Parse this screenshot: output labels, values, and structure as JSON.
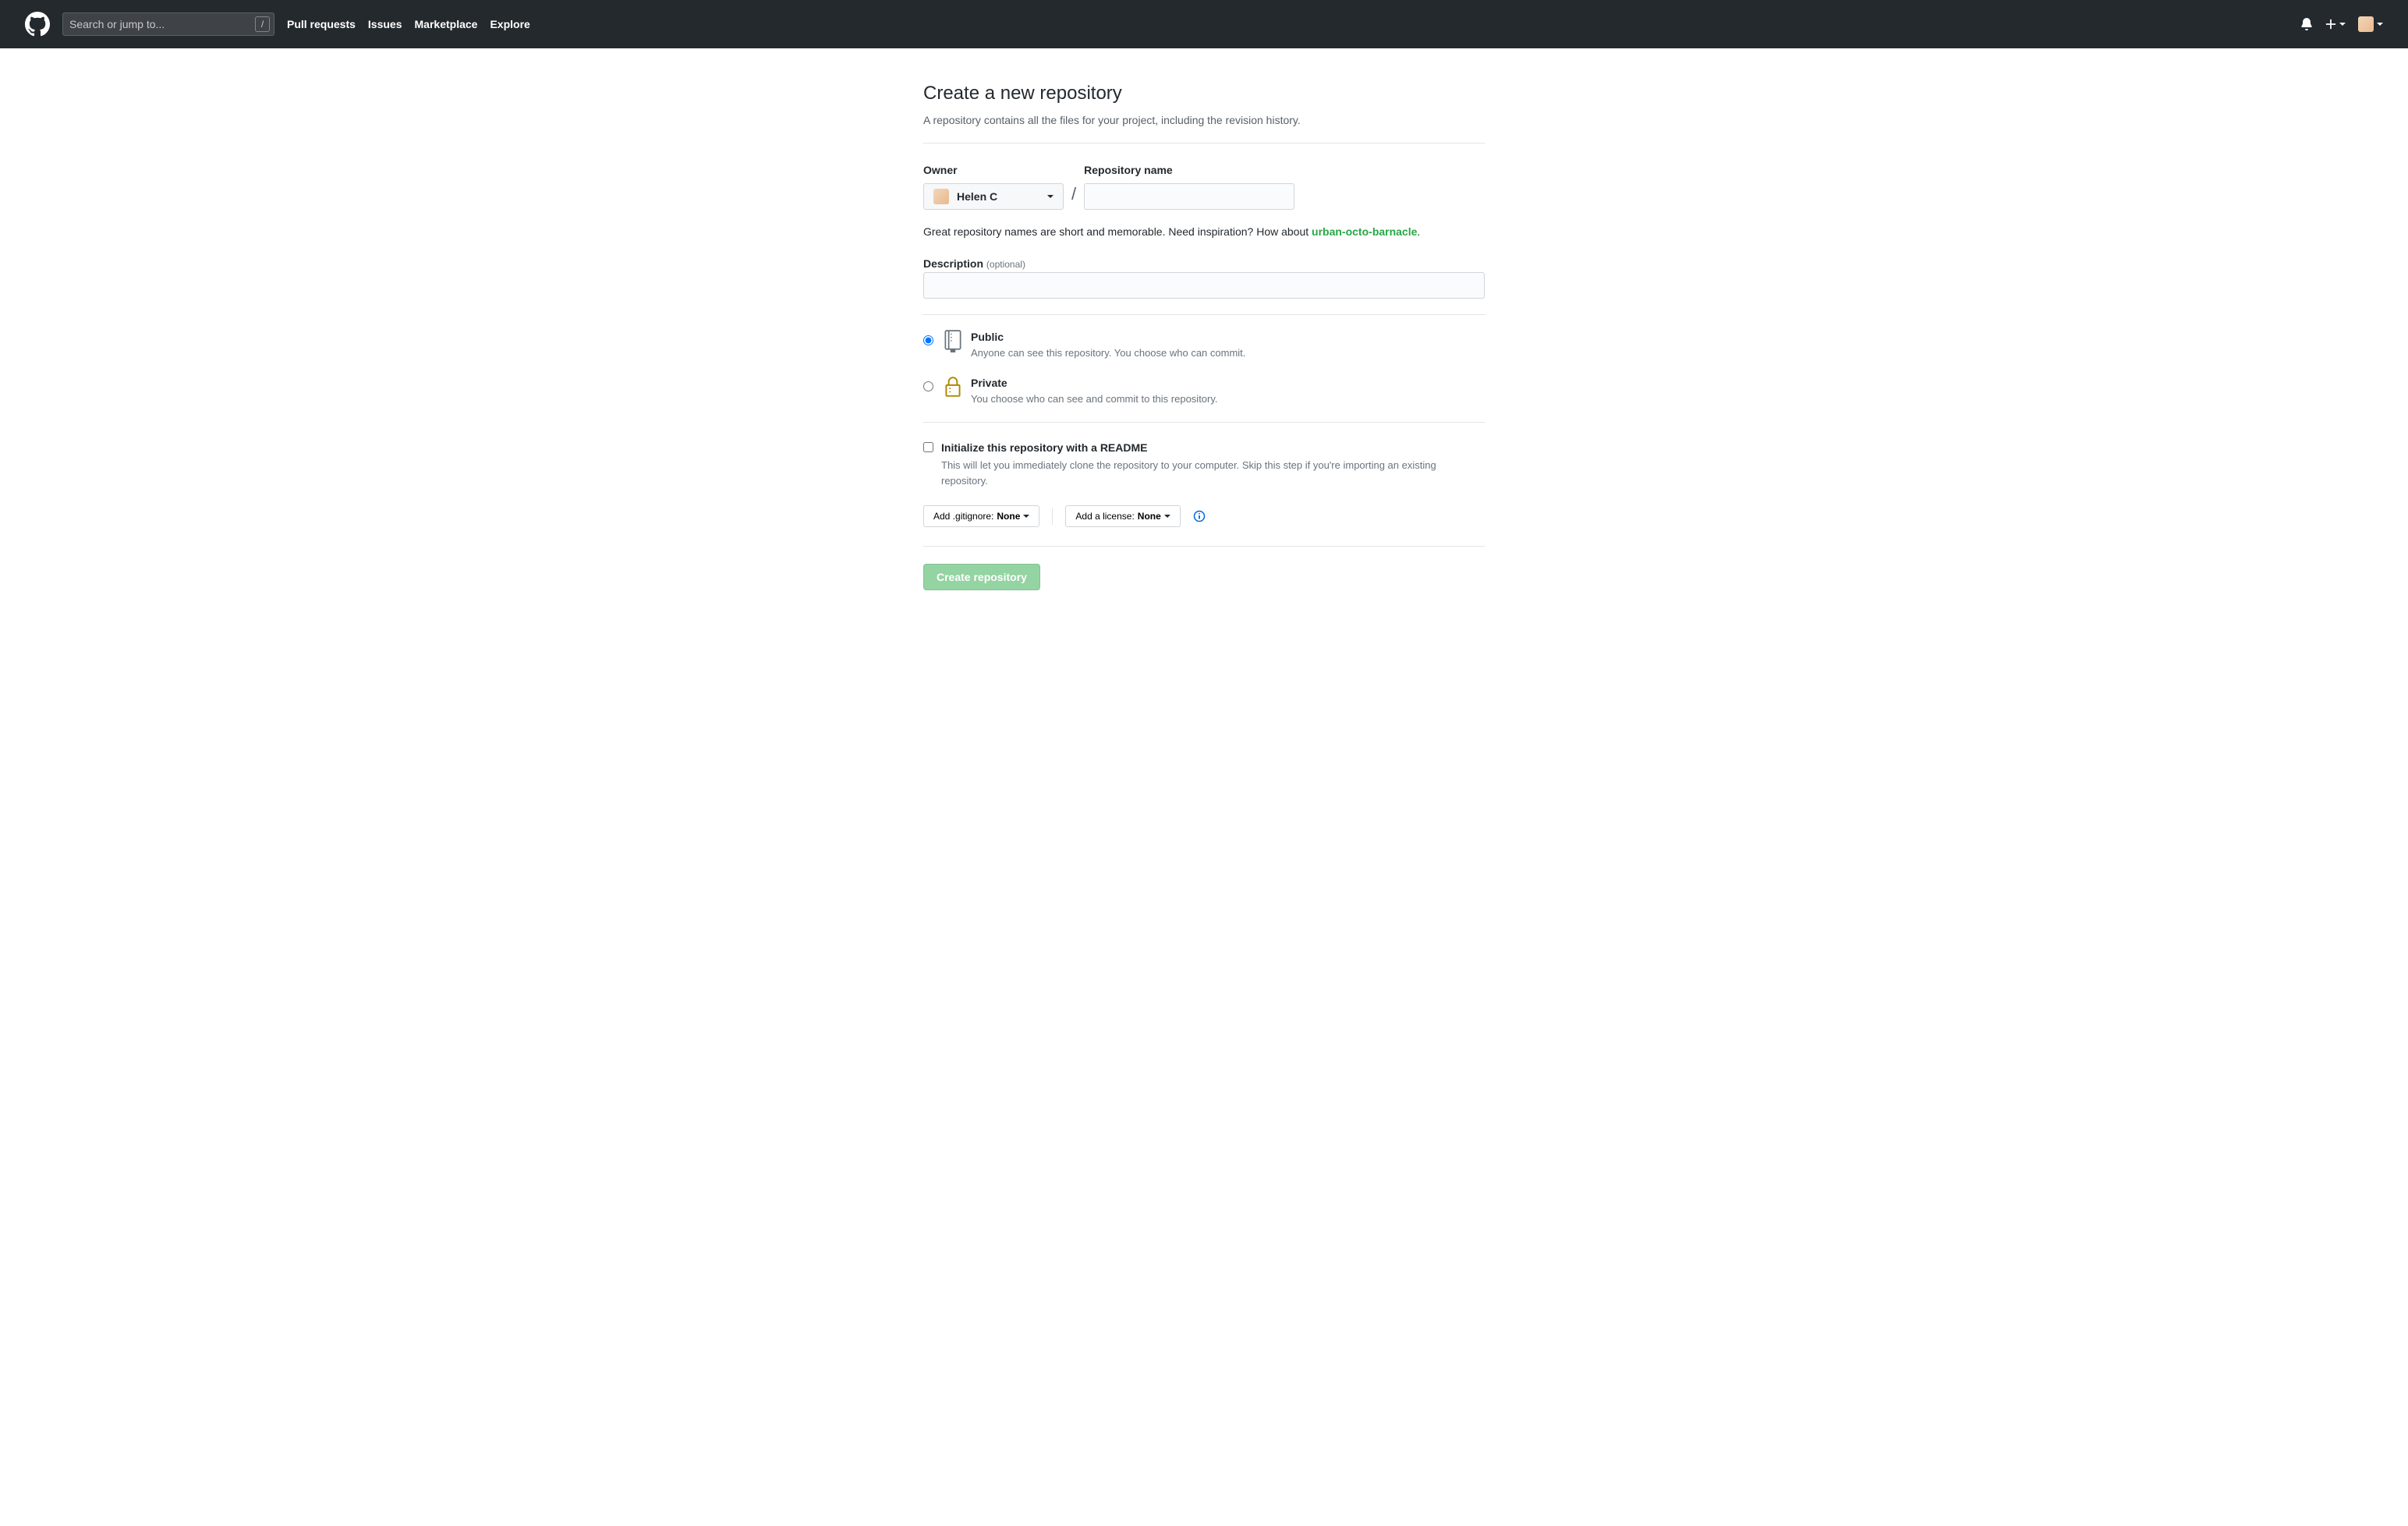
{
  "header": {
    "search_placeholder": "Search or jump to...",
    "slash": "/",
    "nav": [
      "Pull requests",
      "Issues",
      "Marketplace",
      "Explore"
    ]
  },
  "page": {
    "title": "Create a new repository",
    "subtitle": "A repository contains all the files for your project, including the revision history."
  },
  "owner": {
    "label": "Owner",
    "name": "Helen C"
  },
  "repo_name": {
    "label": "Repository name",
    "value": ""
  },
  "hint": {
    "prefix": "Great repository names are short and memorable. Need inspiration? How about ",
    "suggestion": "urban-octo-barnacle",
    "suffix": "."
  },
  "description": {
    "label": "Description",
    "optional": "(optional)",
    "value": ""
  },
  "visibility": {
    "public": {
      "title": "Public",
      "desc": "Anyone can see this repository. You choose who can commit."
    },
    "private": {
      "title": "Private",
      "desc": "You choose who can see and commit to this repository."
    }
  },
  "init": {
    "label": "Initialize this repository with a README",
    "desc": "This will let you immediately clone the repository to your computer. Skip this step if you're importing an existing repository."
  },
  "gitignore": {
    "prefix": "Add .gitignore: ",
    "value": "None"
  },
  "license": {
    "prefix": "Add a license: ",
    "value": "None"
  },
  "submit": {
    "label": "Create repository"
  }
}
